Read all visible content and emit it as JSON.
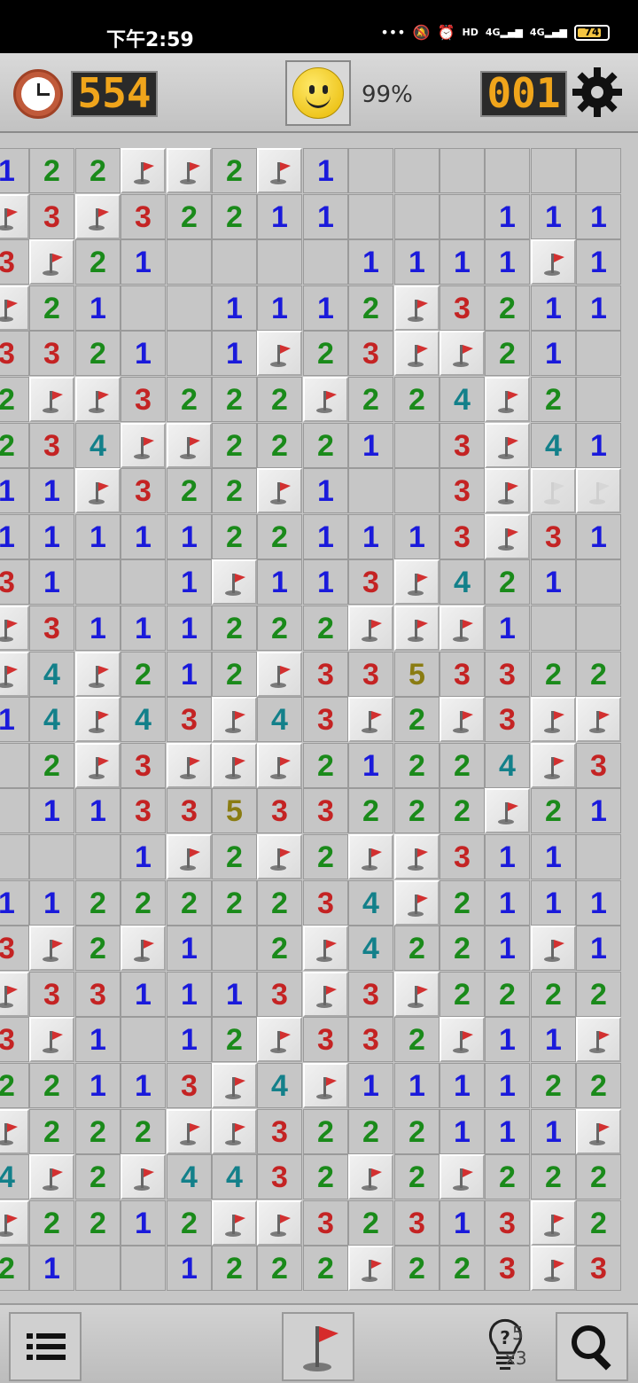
{
  "status_bar": {
    "time": "下午2:59",
    "network": "4G",
    "battery": "74"
  },
  "toolbar": {
    "timer": "554",
    "progress": "99%",
    "mines_left": "001"
  },
  "board": {
    "rows": [
      [
        "1",
        "2",
        "2",
        "F",
        "F",
        "2",
        "F",
        "1",
        "",
        "",
        "",
        "",
        "",
        ""
      ],
      [
        "F",
        "3",
        "F",
        "3",
        "2",
        "2",
        "1",
        "1",
        "",
        "",
        "",
        "1",
        "1",
        "1"
      ],
      [
        "3",
        "F",
        "2",
        "1",
        "",
        "",
        "",
        "",
        "1",
        "1",
        "1",
        "1",
        "F",
        "1"
      ],
      [
        "F",
        "2",
        "1",
        "",
        "",
        "1",
        "1",
        "1",
        "2",
        "F",
        "3",
        "2",
        "1",
        "1"
      ],
      [
        "3",
        "3",
        "2",
        "1",
        "",
        "1",
        "F",
        "2",
        "3",
        "F",
        "F",
        "2",
        "1",
        ""
      ],
      [
        "2",
        "F",
        "F",
        "3",
        "2",
        "2",
        "2",
        "F",
        "2",
        "2",
        "4",
        "F",
        "2",
        ""
      ],
      [
        "2",
        "3",
        "4",
        "F",
        "F",
        "2",
        "2",
        "2",
        "1",
        "",
        "3",
        "F",
        "4",
        "1"
      ],
      [
        "1",
        "1",
        "F",
        "3",
        "2",
        "2",
        "F",
        "1",
        "",
        "",
        "3",
        "F",
        "FF",
        "FF"
      ],
      [
        "1",
        "1",
        "1",
        "1",
        "1",
        "2",
        "2",
        "1",
        "1",
        "1",
        "3",
        "F",
        "3",
        "1"
      ],
      [
        "3",
        "1",
        "",
        "",
        "1",
        "F",
        "1",
        "1",
        "3",
        "F",
        "4",
        "2",
        "1",
        ""
      ],
      [
        "F",
        "3",
        "1",
        "1",
        "1",
        "2",
        "2",
        "2",
        "F",
        "F",
        "F",
        "1",
        "",
        ""
      ],
      [
        "F",
        "4",
        "F",
        "2",
        "1",
        "2",
        "F",
        "3",
        "3",
        "5",
        "3",
        "3",
        "2",
        "2"
      ],
      [
        "1",
        "4",
        "F",
        "4",
        "3",
        "F",
        "4",
        "3",
        "F",
        "2",
        "F",
        "3",
        "F",
        "F"
      ],
      [
        "",
        "2",
        "F",
        "3",
        "F",
        "F",
        "F",
        "2",
        "1",
        "2",
        "2",
        "4",
        "F",
        "3"
      ],
      [
        "",
        "1",
        "1",
        "3",
        "3",
        "5",
        "3",
        "3",
        "2",
        "2",
        "2",
        "F",
        "2",
        "1"
      ],
      [
        "",
        "",
        "",
        "1",
        "F",
        "2",
        "F",
        "2",
        "F",
        "F",
        "3",
        "1",
        "1",
        ""
      ],
      [
        "1",
        "1",
        "2",
        "2",
        "2",
        "2",
        "2",
        "3",
        "4",
        "F",
        "2",
        "1",
        "1",
        "1"
      ],
      [
        "3",
        "F",
        "2",
        "F",
        "1",
        "",
        "2",
        "F",
        "4",
        "2",
        "2",
        "1",
        "F",
        "1"
      ],
      [
        "F",
        "3",
        "3",
        "1",
        "1",
        "1",
        "3",
        "F",
        "3",
        "F",
        "2",
        "2",
        "2",
        "2"
      ],
      [
        "3",
        "F",
        "1",
        "",
        "1",
        "2",
        "F",
        "3",
        "3",
        "2",
        "F",
        "1",
        "1",
        "F"
      ],
      [
        "2",
        "2",
        "1",
        "1",
        "3",
        "F",
        "4",
        "F",
        "1",
        "1",
        "1",
        "1",
        "2",
        "2"
      ],
      [
        "F",
        "2",
        "2",
        "2",
        "F",
        "F",
        "3",
        "2",
        "2",
        "2",
        "1",
        "1",
        "1",
        "F"
      ],
      [
        "4",
        "F",
        "2",
        "F",
        "4",
        "4",
        "3",
        "2",
        "F",
        "2",
        "F",
        "2",
        "2",
        "2"
      ],
      [
        "F",
        "2",
        "2",
        "1",
        "2",
        "F",
        "F",
        "3",
        "2",
        "3",
        "1",
        "3",
        "F",
        "2"
      ],
      [
        "2",
        "1",
        "",
        "",
        "1",
        "2",
        "2",
        "2",
        "F",
        "2",
        "2",
        "3",
        "F",
        "3"
      ]
    ]
  },
  "bottom": {
    "hint_count": "5",
    "hint_multiplier": "x3"
  }
}
